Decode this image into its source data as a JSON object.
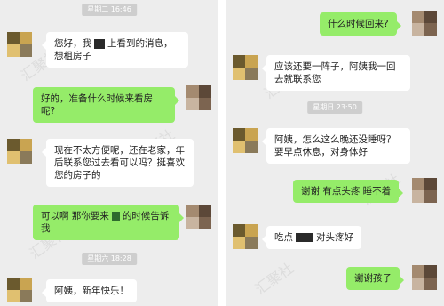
{
  "left": {
    "timestamps": [
      "星期二 16:46",
      "星期六 18:28"
    ],
    "messages": [
      {
        "from": "landlady",
        "parts": [
          "您好，我",
          "",
          "上看到的消息，想租房子"
        ]
      },
      {
        "from": "me",
        "text": "好的，准备什么时候来看房呢?"
      },
      {
        "from": "landlady",
        "text": "现在不太方便呢，还在老家，年后联系您过去看可以吗？挺喜欢您的房子的"
      },
      {
        "from": "me",
        "parts": [
          "可以啊 那你要来",
          "",
          "的时候告诉我"
        ]
      },
      {
        "from": "landlady",
        "text": "阿姨，新年快乐！"
      }
    ]
  },
  "right": {
    "timestamps": [
      "星期日 23:50"
    ],
    "messages": [
      {
        "from": "me",
        "text": "什么时候回来?"
      },
      {
        "from": "landlady",
        "text": "应该还要一阵子，阿姨我一回去就联系您"
      },
      {
        "from": "landlady",
        "text": "阿姨，怎么这么晚还没睡呀？要早点休息，对身体好"
      },
      {
        "from": "me",
        "text": "谢谢 有点头疼 睡不着"
      },
      {
        "from": "landlady",
        "parts": [
          "吃点",
          "",
          "对头疼好"
        ]
      },
      {
        "from": "me",
        "text": "谢谢孩子"
      }
    ]
  },
  "watermark": "汇聚社",
  "colors": {
    "background": "#ededed",
    "bubble_out": "#95ec69",
    "bubble_in": "#ffffff"
  }
}
